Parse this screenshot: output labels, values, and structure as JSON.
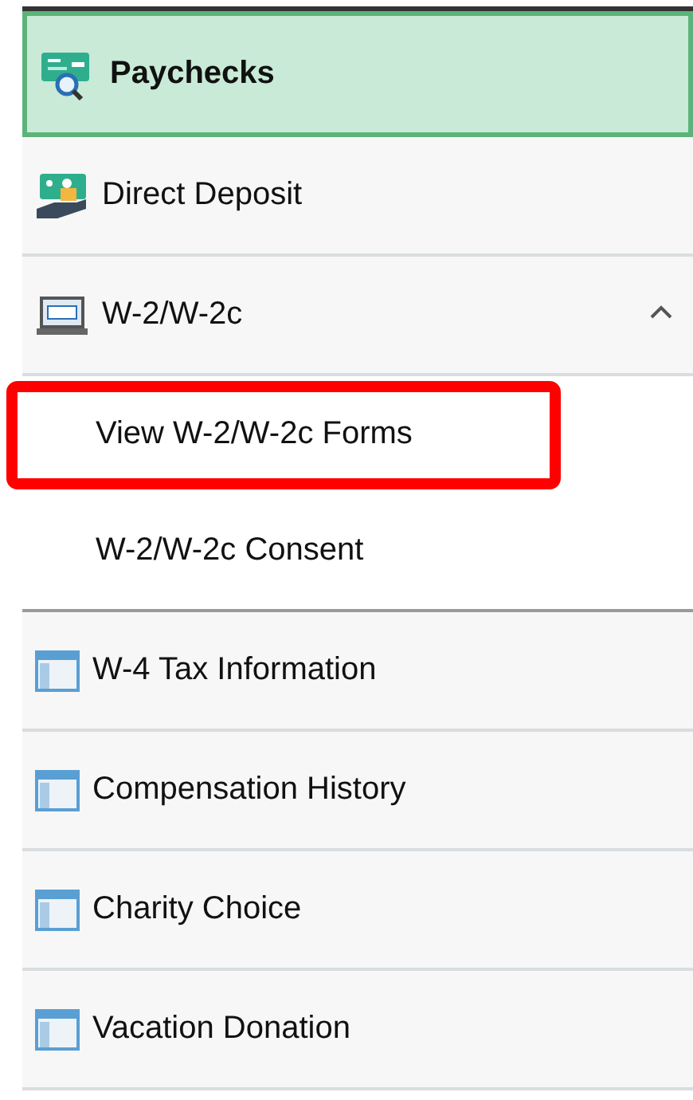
{
  "menu": {
    "items": [
      {
        "label": "Paychecks",
        "kind": "paycheck",
        "selected": true
      },
      {
        "label": "Direct Deposit",
        "kind": "deposit",
        "selected": false
      },
      {
        "label": "W-2/W-2c",
        "kind": "w2",
        "selected": false,
        "expanded": true,
        "children": [
          {
            "label": "View W-2/W-2c Forms",
            "selected": false,
            "highlighted": true
          },
          {
            "label": "W-2/W-2c Consent",
            "selected": false,
            "highlighted": false
          }
        ]
      },
      {
        "label": "W-4 Tax Information",
        "kind": "page",
        "selected": false
      },
      {
        "label": "Compensation History",
        "kind": "page",
        "selected": false
      },
      {
        "label": "Charity Choice",
        "kind": "page",
        "selected": false
      },
      {
        "label": "Vacation Donation",
        "kind": "page",
        "selected": false
      }
    ]
  }
}
